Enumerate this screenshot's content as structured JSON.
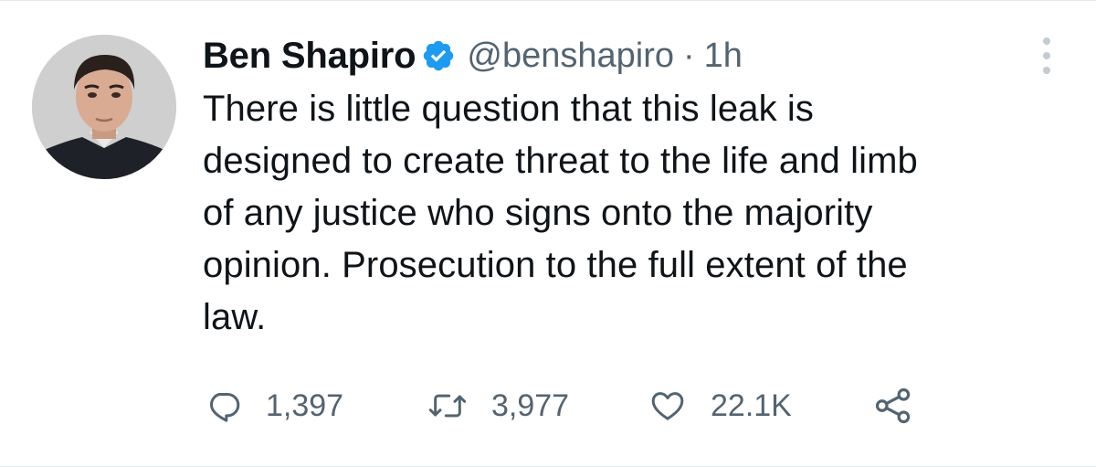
{
  "tweet": {
    "author_name": "Ben Shapiro",
    "handle": "@benshapiro",
    "separator": "·",
    "time": "1h",
    "verified": true,
    "text": "There is little question that this leak is\ndesigned to create threat to the life and limb\nof any justice who signs onto the majority\nopinion. Prosecution to the full extent of the\nlaw.",
    "replies": "1,397",
    "retweets": "3,977",
    "likes": "22.1K"
  },
  "icons": {
    "reply": "reply-icon",
    "retweet": "retweet-icon",
    "like": "heart-icon",
    "share": "share-icon",
    "more": "more-icon",
    "verified": "verified-badge-icon"
  },
  "colors": {
    "text": "#0f1419",
    "secondary": "#536471",
    "verified": "#1d9bf0",
    "border": "#e6e9eb"
  }
}
